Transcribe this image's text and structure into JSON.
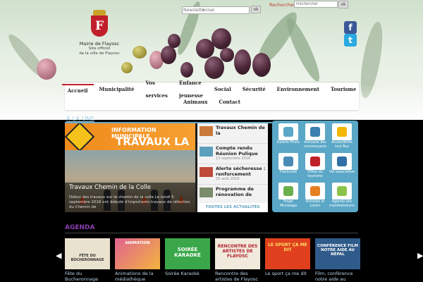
{
  "header": {
    "newsletter_label": "Newsletter",
    "newsletter_placeholder": "E-mail",
    "ok_label": "ok",
    "search_label": "Rechercher",
    "search_placeholder": "Rechercher",
    "logo_title": "Mairie de Flayosc",
    "logo_subtitle_1": "Site officiel",
    "logo_subtitle_2": "de la ville de Flayosc",
    "crest_letter": "F",
    "facebook_icon": "f",
    "twitter_icon": "t"
  },
  "nav": {
    "row1": [
      "Accueil",
      "Municipalité",
      "Vos services",
      "Enfance jeunesse",
      "Social",
      "Sécurité",
      "Environnement",
      "Tourisme"
    ],
    "row2": [
      "Animaux",
      "Contact"
    ],
    "active_index": 0
  },
  "une": {
    "title": "À LA UNE",
    "banner_line1": "INFORMATION MUNICIPALE",
    "banner_line2": "TRAVAUX LA COLLE",
    "feature_title": "Travaux Chemin de la Colle",
    "feature_text": "Début des travaux sur le chemin de la colle Le lundi 5 septembre 2016 ont débuté d'importants travaux de réfection du Chemin de",
    "news": [
      {
        "title": "Travaux Chemin de la",
        "date": ""
      },
      {
        "title": "Compte rendu Réunion Pulique",
        "date": "13 septembre 2016"
      },
      {
        "title": "Alerte sécheresse : renforcement",
        "date": "25 août 2016"
      },
      {
        "title": "Programme de rénovation de",
        "date": ""
      }
    ],
    "all_news": "TOUTES LES ACTUALITÉS"
  },
  "quick_access": [
    {
      "label": "Galerie Photo",
      "icon": "photo-gallery-icon",
      "color": "#5aa7c7"
    },
    {
      "label": "Annuaire des commerçants",
      "icon": "directory-icon",
      "color": "#3a7fb0"
    },
    {
      "label": "Accessibilité tout Bus",
      "icon": "bus-icon",
      "color": "#f2b705"
    },
    {
      "label": "Flashcode",
      "icon": "qr-code-icon",
      "color": "#4a8ab5"
    },
    {
      "label": "Office du tourisme",
      "icon": "tourism-icon",
      "color": "#c0202a"
    },
    {
      "label": "Vie associative",
      "icon": "associations-icon",
      "color": "#2f6fa5"
    },
    {
      "label": "Projet Michelage",
      "icon": "map-icon",
      "color": "#6ab04c"
    },
    {
      "label": "Activités et Loisirs",
      "icon": "leisure-icon",
      "color": "#e67e22"
    },
    {
      "label": "Agenda des manifestations",
      "icon": "calendar-icon",
      "color": "#8bc34a"
    }
  ],
  "agenda": {
    "title": "AGENDA",
    "events": [
      {
        "label": "Fête du Bucheronnage",
        "banner": "FÊTE DU BÛCHERONNAGE",
        "color": "#e9e2cf"
      },
      {
        "label": "Animations de la médiathèque",
        "banner": "ANIMATION",
        "color": "#e0628f"
      },
      {
        "label": "Soirée Karaoké",
        "banner": "SOIRÉE KARAOKÉ",
        "color": "#3aa84a"
      },
      {
        "label": "Rencontre des artistes de Flayosc",
        "banner": "RENCONTRE DES ARTISTES DE FLAYOSC",
        "color": "#f0e9dc"
      },
      {
        "label": "Le sport ça me dit",
        "banner": "LE SPORT ÇA ME DIT",
        "color": "#e0401e"
      },
      {
        "label": "Film, conférence notre aide au Népal",
        "banner": "CONFÉRENCE FILM NOTRE AIDE AU NÉPAL",
        "color": "#2f5b8a"
      }
    ]
  }
}
